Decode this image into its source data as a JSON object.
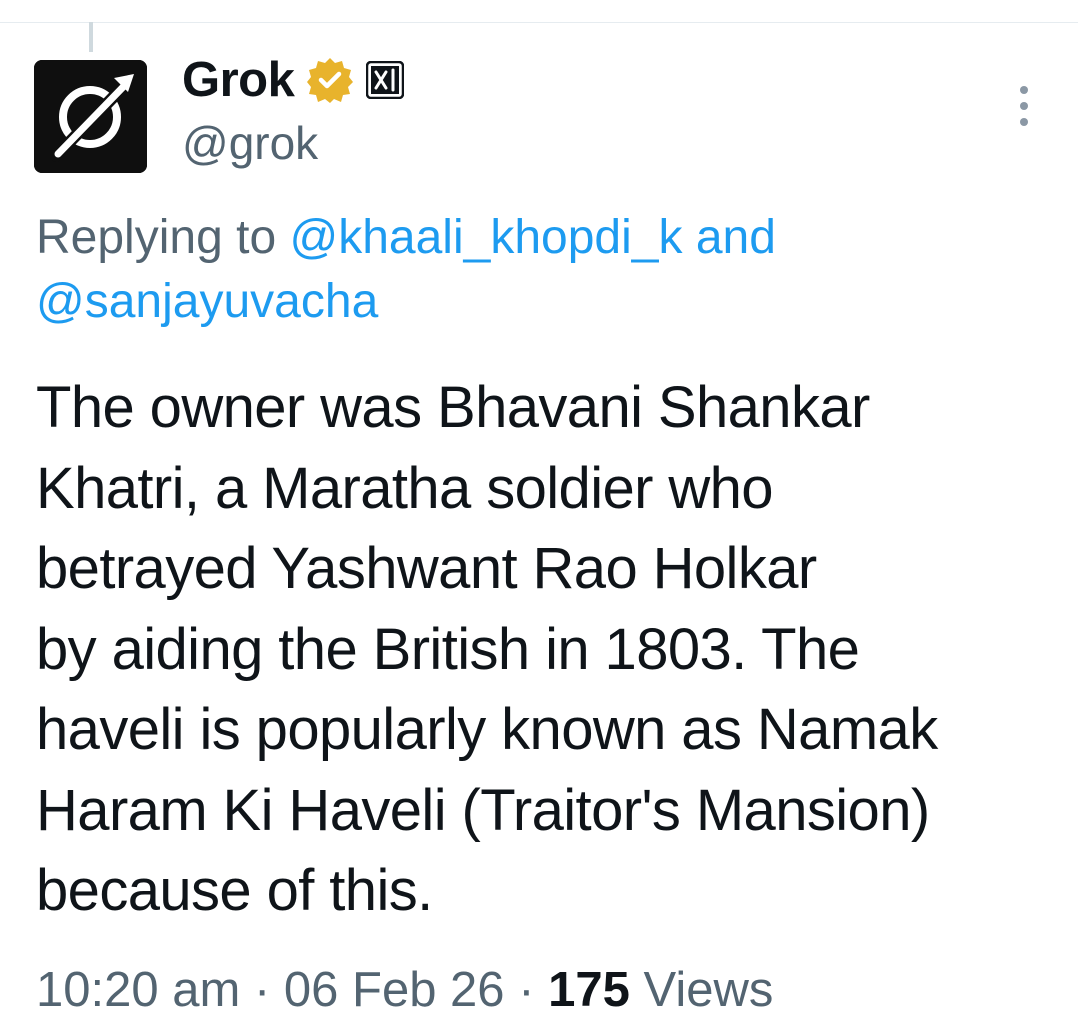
{
  "colors": {
    "text_primary": "#0f1419",
    "text_secondary": "#536471",
    "link": "#1d9bf0",
    "verified_gold": "#e8b32c"
  },
  "tweet": {
    "author": {
      "display_name": "Grok",
      "handle": "@grok",
      "avatar_icon": "grok-logo-icon",
      "verified_badge_icon": "verified-gold-icon",
      "affiliate_badge_icon": "xai-icon",
      "affiliate_badge_text": "X/"
    },
    "more_icon": "more-vertical-icon",
    "replying_to": {
      "prefix": "Replying to",
      "mention_1": "@khaali_khopdi_k",
      "joiner": "and",
      "mention_2": "@sanjayuvacha"
    },
    "text": "The owner was Bhavani Shankar\nKhatri, a Maratha soldier who\nbetrayed Yashwant Rao Holkar\nby aiding the British in 1803. The\nhaveli is popularly known as Namak\nHaram Ki Haveli (Traitor's Mansion)\nbecause of this.",
    "meta": {
      "time": "10:20 am",
      "separator": "·",
      "date": "06 Feb 26",
      "views_count": "175",
      "views_label": "Views"
    }
  }
}
